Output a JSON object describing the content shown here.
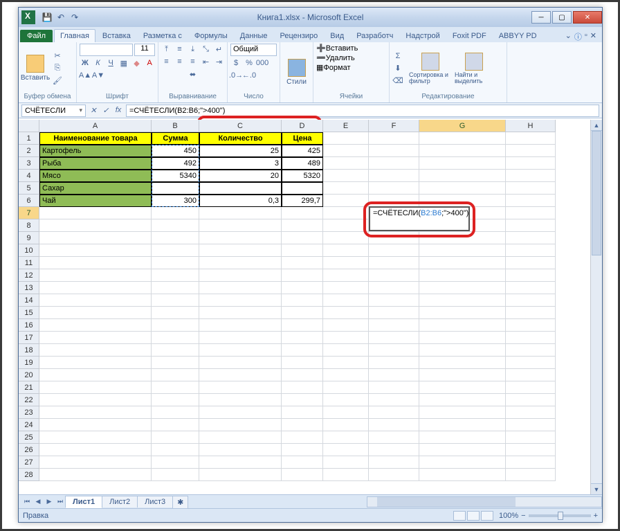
{
  "window": {
    "title": "Книга1.xlsx - Microsoft Excel"
  },
  "qat": {
    "save": "💾",
    "undo": "↶",
    "redo": "↷"
  },
  "tabs": {
    "file": "Файл",
    "items": [
      "Главная",
      "Вставка",
      "Разметка с",
      "Формулы",
      "Данные",
      "Рецензиро",
      "Вид",
      "Разработч",
      "Надстрой",
      "Foxit PDF",
      "ABBYY PD"
    ],
    "active_index": 0
  },
  "ribbon": {
    "clipboard": {
      "paste": "Вставить",
      "group": "Буфер обмена"
    },
    "font": {
      "group": "Шрифт",
      "size": "11",
      "bold": "Ж",
      "italic": "К",
      "underline": "Ч"
    },
    "align": {
      "group": "Выравнивание"
    },
    "number": {
      "format": "Общий",
      "group": "Число"
    },
    "styles": {
      "label": "Стили"
    },
    "cells": {
      "insert": "Вставить",
      "delete": "Удалить",
      "format": "Формат",
      "group": "Ячейки"
    },
    "editing": {
      "sort": "Сортировка и фильтр",
      "find": "Найти и выделить",
      "group": "Редактирование"
    }
  },
  "namebox": {
    "value": "СЧЁТЕСЛИ"
  },
  "formula": {
    "value": "=СЧЁТЕСЛИ(B2:B6;\">400\")"
  },
  "columns": [
    "A",
    "B",
    "C",
    "D",
    "E",
    "F",
    "G",
    "H"
  ],
  "headers": {
    "a": "Наименование товара",
    "b": "Сумма",
    "c": "Количество",
    "d": "Цена"
  },
  "data": [
    {
      "name": "Картофель",
      "sum": "450",
      "qty": "25",
      "price": "425"
    },
    {
      "name": "Рыба",
      "sum": "492",
      "qty": "3",
      "price": "489"
    },
    {
      "name": "Мясо",
      "sum": "5340",
      "qty": "20",
      "price": "5320"
    },
    {
      "name": "Сахар",
      "sum": "",
      "qty": "",
      "price": ""
    },
    {
      "name": "Чай",
      "sum": "300",
      "qty": "0,3",
      "price": "299,7"
    }
  ],
  "edit_cell": {
    "prefix": "=СЧЁТЕСЛИ(",
    "range": "B2:B6",
    "suffix": ";\">400\")"
  },
  "sheets": {
    "tabs": [
      "Лист1",
      "Лист2",
      "Лист3"
    ],
    "active_index": 0
  },
  "statusbar": {
    "mode": "Правка",
    "zoom": "100%"
  },
  "chart_data": {
    "type": "table",
    "columns": [
      "Наименование товара",
      "Сумма",
      "Количество",
      "Цена"
    ],
    "rows": [
      [
        "Картофель",
        450,
        25,
        425
      ],
      [
        "Рыба",
        492,
        3,
        489
      ],
      [
        "Мясо",
        5340,
        20,
        5320
      ],
      [
        "Сахар",
        null,
        null,
        null
      ],
      [
        "Чай",
        300,
        0.3,
        299.7
      ]
    ],
    "formula_cell": "G7",
    "formula": "=СЧЁТЕСЛИ(B2:B6;\">400\")"
  }
}
